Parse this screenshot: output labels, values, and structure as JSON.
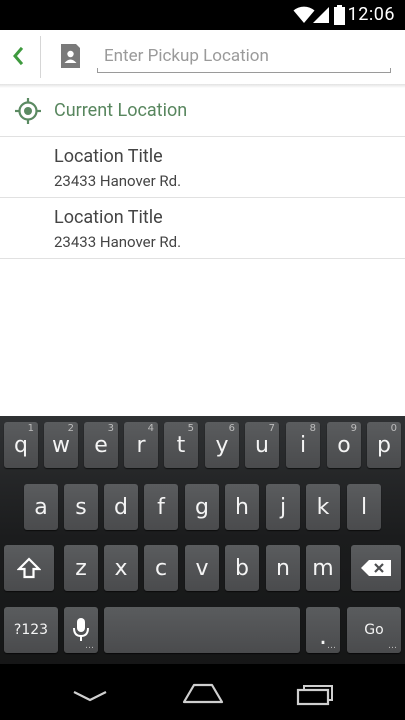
{
  "status_bar": {
    "time": "12:06"
  },
  "search": {
    "placeholder": "Enter Pickup Location",
    "value": ""
  },
  "current_location": {
    "label": "Current Location"
  },
  "locations": [
    {
      "title": "Location Title",
      "address": "23433 Hanover Rd."
    },
    {
      "title": "Location Title",
      "address": "23433 Hanover Rd."
    }
  ],
  "keyboard": {
    "row1": [
      {
        "k": "q",
        "h": "1"
      },
      {
        "k": "w",
        "h": "2"
      },
      {
        "k": "e",
        "h": "3"
      },
      {
        "k": "r",
        "h": "4"
      },
      {
        "k": "t",
        "h": "5"
      },
      {
        "k": "y",
        "h": "6"
      },
      {
        "k": "u",
        "h": "7"
      },
      {
        "k": "i",
        "h": "8"
      },
      {
        "k": "o",
        "h": "9"
      },
      {
        "k": "p",
        "h": "0"
      }
    ],
    "row2": [
      "a",
      "s",
      "d",
      "f",
      "g",
      "h",
      "j",
      "k",
      "l"
    ],
    "row3": [
      "z",
      "x",
      "c",
      "v",
      "b",
      "n",
      "m"
    ],
    "symbols_label": "?123",
    "period_label": ".",
    "go_label": "Go"
  },
  "colors": {
    "accent_green": "#58865e",
    "status_bar": "#000000",
    "keyboard_key": "#525456"
  }
}
